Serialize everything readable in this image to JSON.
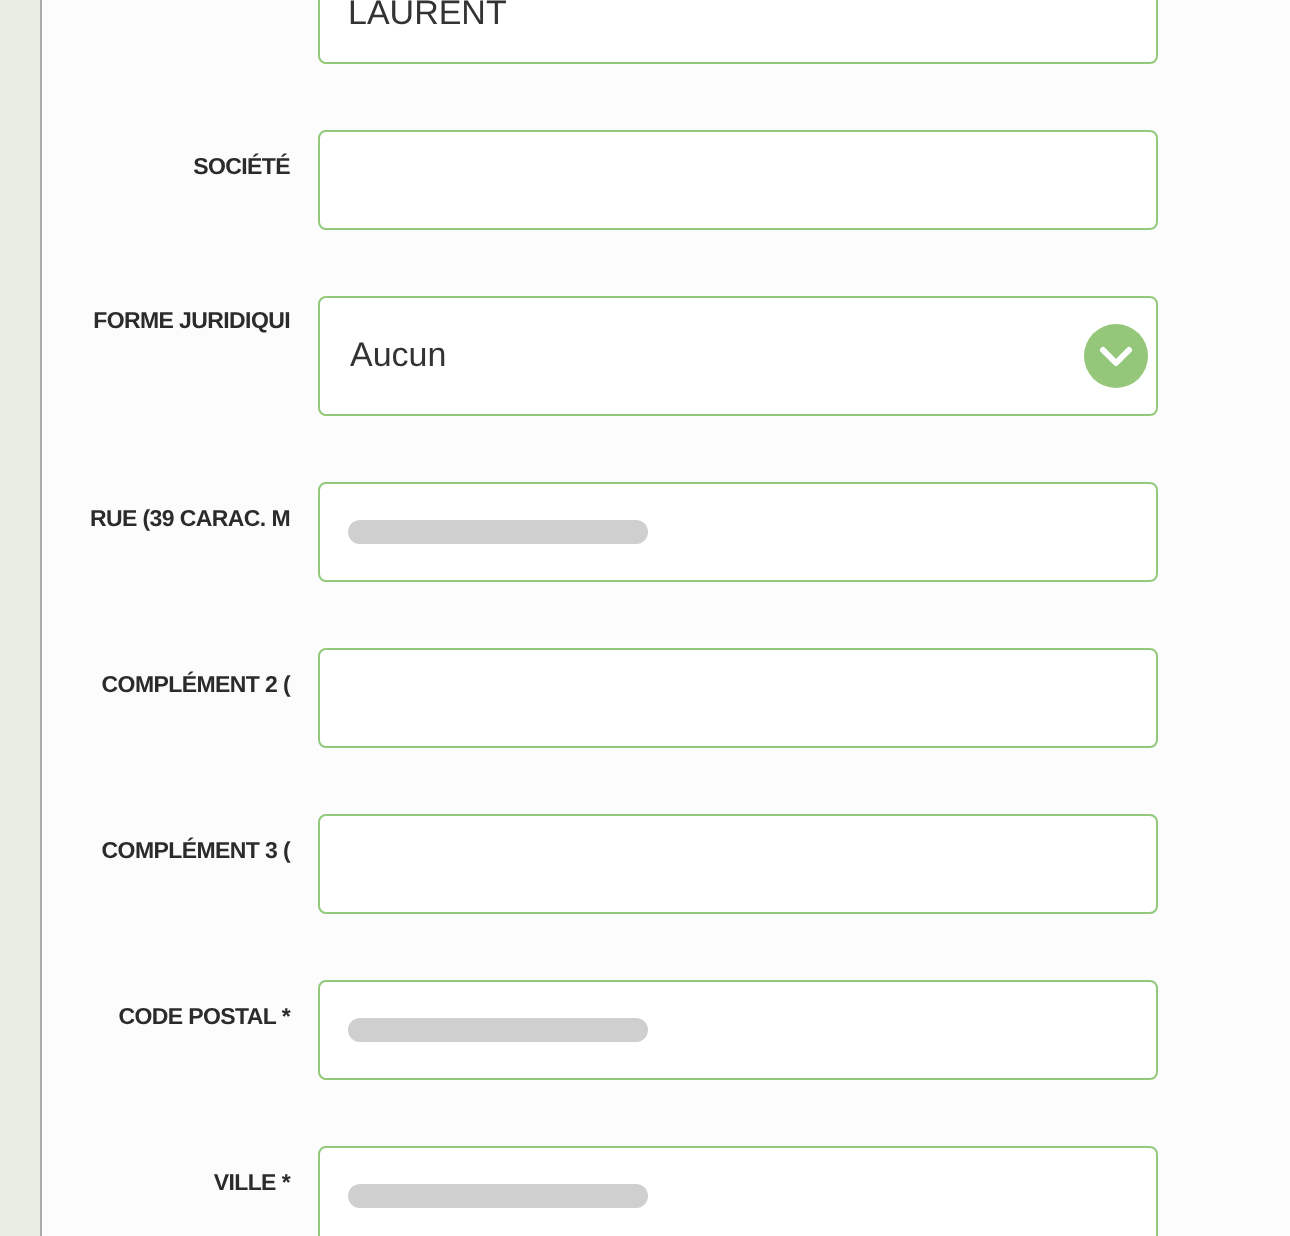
{
  "fields": [
    {
      "kind": "text",
      "value": "LAURENT",
      "redacted": false
    },
    {
      "label": "SOCIÉTÉ",
      "kind": "text",
      "redacted": false
    },
    {
      "label": "FORME JURIDIQUI",
      "kind": "select",
      "value": "Aucun"
    },
    {
      "label": "RUE (39 CARAC. M",
      "kind": "text",
      "redacted": true
    },
    {
      "label": "COMPLÉMENT 2 (",
      "kind": "text",
      "redacted": false
    },
    {
      "label": "COMPLÉMENT 3 (",
      "kind": "text",
      "redacted": false
    },
    {
      "label": "CODE POSTAL *",
      "kind": "text",
      "redacted": true
    },
    {
      "label": "VILLE *",
      "kind": "text",
      "redacted": true
    }
  ]
}
